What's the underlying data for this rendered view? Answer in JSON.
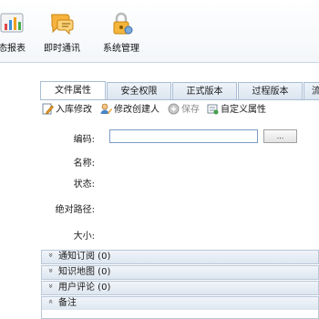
{
  "toolbar": {
    "items": [
      {
        "label": "态报表",
        "icon": "report-chart-icon"
      },
      {
        "label": "即时通讯",
        "icon": "chat-bubbles-icon"
      },
      {
        "label": "系统管理",
        "icon": "system-lock-icon"
      }
    ]
  },
  "tabs": [
    {
      "label": "文件属性",
      "active": true
    },
    {
      "label": "安全权限",
      "active": false
    },
    {
      "label": "正式版本",
      "active": false
    },
    {
      "label": "过程版本",
      "active": false
    },
    {
      "label": "流",
      "active": false
    }
  ],
  "actions": [
    {
      "label": "入库修改",
      "icon": "edit-doc-icon",
      "enabled": true
    },
    {
      "label": "修改创建人",
      "icon": "user-edit-icon",
      "enabled": true
    },
    {
      "label": "保存",
      "icon": "save-icon",
      "enabled": false
    },
    {
      "label": "自定义属性",
      "icon": "custom-attr-icon",
      "enabled": true
    }
  ],
  "form": {
    "code_label": "编码:",
    "code_value": "",
    "browse_label": "...",
    "name_label": "名称:",
    "status_label": "状态:",
    "path_label": "绝对路径:",
    "size_label": "大小:"
  },
  "panels": [
    {
      "label": "通知订阅 (0)",
      "collapsed": true
    },
    {
      "label": "知识地图 (0)",
      "collapsed": true
    },
    {
      "label": "用户评论 (0)",
      "collapsed": true
    },
    {
      "label": "备注",
      "collapsed": false
    }
  ],
  "colors": {
    "accent": "#2f6fb5",
    "tab_border": "#a9bdd3"
  }
}
